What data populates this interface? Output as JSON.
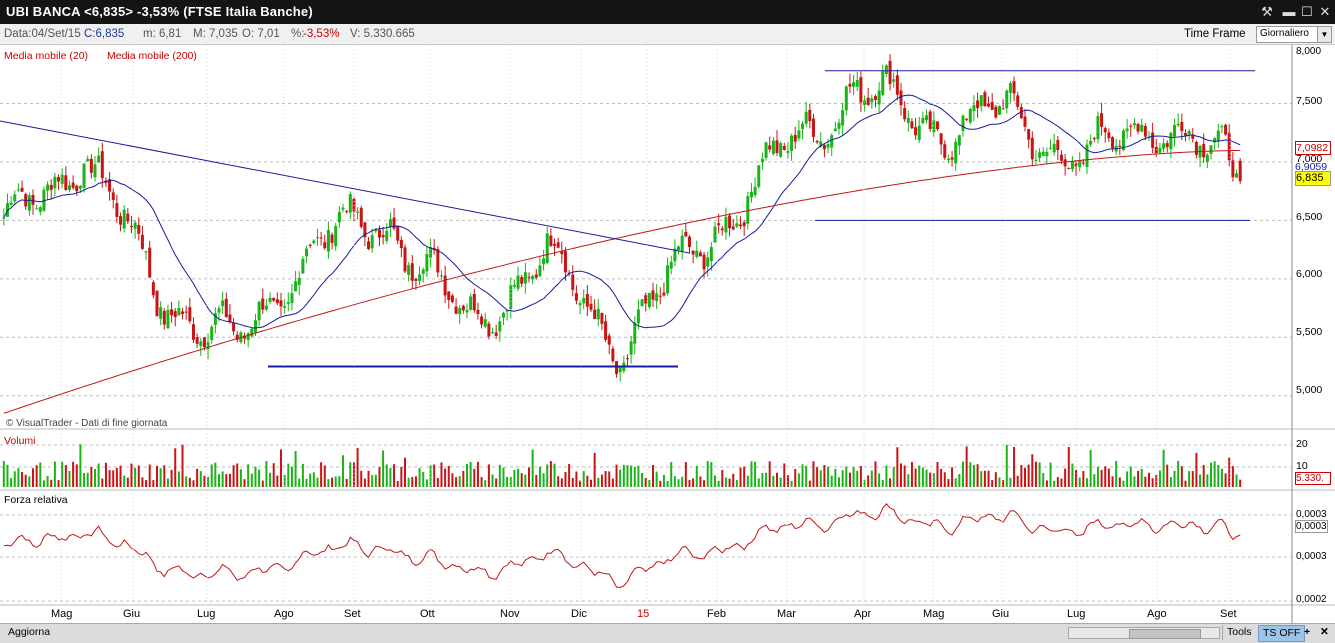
{
  "window": {
    "title": "UBI BANCA <6,835> -3,53% (FTSE Italia Banche)"
  },
  "info": {
    "date": "Data:04/Set/15",
    "close": "C:6,835",
    "min": "m: 6,81",
    "max": "M: 7,035",
    "open": "O: 7,01",
    "pct_label": "%:",
    "pct": "-3,53%",
    "volume": "V: 5.330.665",
    "timeframe_label": "Time Frame",
    "timeframe_value": "Giornaliero"
  },
  "legend": {
    "ma20": "Media mobile (20)",
    "ma200": "Media mobile (200)",
    "watermark": "© VisualTrader - Dati di fine giornata",
    "volume_title": "Volumi",
    "rs_title": "Forza relativa"
  },
  "price_axis": {
    "ticks": [
      "7,500",
      "7,000",
      "6,500",
      "6,000",
      "5,500",
      "5,000"
    ],
    "top_cut": "8,000",
    "badge_ma200": "7,0982",
    "badge_ma20": "6,9059",
    "badge_last": "6,835"
  },
  "volume_axis": {
    "ticks": [
      "20",
      "10"
    ],
    "badge": "5.330."
  },
  "rs_axis": {
    "ticks": [
      "0,0003",
      "0,0003",
      "0,0003",
      "0,0002"
    ]
  },
  "x_axis": {
    "labels": [
      "Mag",
      "Giu",
      "Lug",
      "Ago",
      "Set",
      "Ott",
      "Nov",
      "Dic",
      "15",
      "Feb",
      "Mar",
      "Apr",
      "Mag",
      "Giu",
      "Lug",
      "Ago",
      "Set"
    ]
  },
  "bottom": {
    "update_button": "Aggiorna",
    "tools_button": "Tools",
    "ts_button": "TS OFF",
    "plus_button": "+"
  },
  "colors": {
    "up_candle": "#18b418",
    "down_candle": "#c81414",
    "ma20": "#1a1aa0",
    "ma200": "#c01818",
    "trendline": "#1a1aa0",
    "last_badge": "#ffff00"
  },
  "chart_data": {
    "type": "candlestick",
    "xlabels": [
      "Mag",
      "Giu",
      "Lug",
      "Ago",
      "Set",
      "Ott",
      "Nov",
      "Dic",
      "15",
      "Feb",
      "Mar",
      "Apr",
      "Mag",
      "Giu",
      "Lug",
      "Ago",
      "Set"
    ],
    "last": {
      "open": 7.01,
      "high": 7.035,
      "low": 6.81,
      "close": 6.835
    },
    "last_change_pct": -3.53,
    "last_volume": 5330665,
    "ma200_value": 7.0982,
    "ma20_value": 6.9059,
    "approx_price_path": [
      {
        "label": "Mag",
        "value": 6.4
      },
      {
        "label": "Giu",
        "value": 7.1
      },
      {
        "label": "Lug",
        "value": 5.9
      },
      {
        "label": "Ago",
        "value": 5.4
      },
      {
        "label": "Set",
        "value": 6.3
      },
      {
        "label": "Ott",
        "value": 6.5
      },
      {
        "label": "Nov",
        "value": 5.6
      },
      {
        "label": "Dic",
        "value": 6.2
      },
      {
        "label": "15",
        "value": 5.4
      },
      {
        "label": "Feb",
        "value": 6.3
      },
      {
        "label": "Mar",
        "value": 7.0
      },
      {
        "label": "Apr",
        "value": 7.65
      },
      {
        "label": "Mag",
        "value": 7.3
      },
      {
        "label": "Giu",
        "value": 7.4
      },
      {
        "label": "Lug",
        "value": 7.0
      },
      {
        "label": "Ago",
        "value": 7.4
      },
      {
        "label": "Set",
        "value": 6.835
      }
    ],
    "horizontal_levels": [
      5.25,
      6.5,
      7.78
    ],
    "ylim": [
      4.75,
      8.0
    ]
  }
}
